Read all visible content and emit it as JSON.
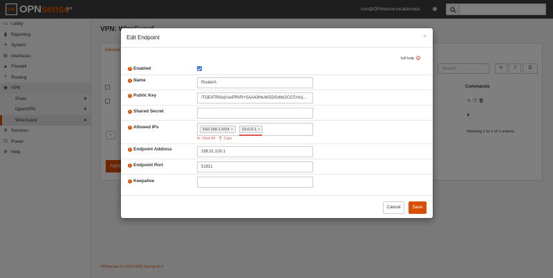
{
  "header": {
    "logo_text_opn": "OPN",
    "logo_text_sense": "sense",
    "logo_reg": "®",
    "collapse_icon": "chevron-left-icon",
    "user": "root@OPNsense.localdomain",
    "search_value": ""
  },
  "sidebar": {
    "items": [
      {
        "label": "Lobby",
        "icon": "laptop-icon"
      },
      {
        "label": "Reporting",
        "icon": "bar-chart-icon"
      },
      {
        "label": "System",
        "icon": "server-icon"
      },
      {
        "label": "Interfaces",
        "icon": "sitemap-icon"
      },
      {
        "label": "Firewall",
        "icon": "fire-icon"
      },
      {
        "label": "Routing",
        "icon": "signpost-icon"
      },
      {
        "label": "VPN",
        "icon": "globe-icon"
      },
      {
        "label": "Services",
        "icon": "cog-icon"
      },
      {
        "label": "Power",
        "icon": "power-icon"
      },
      {
        "label": "Help",
        "icon": "help-icon"
      }
    ],
    "vpn_sub": [
      {
        "label": "IPsec"
      },
      {
        "label": "OpenVPN"
      },
      {
        "label": "WireGuard"
      }
    ]
  },
  "background": {
    "page_title": "VPN: WireGuard",
    "tab_general": "General",
    "search_placeholder": "Search",
    "page_size": "7",
    "commands_header": "Commands",
    "showing": "Showing 1 to 1 of 1 entries",
    "apply_label": "Apply",
    "footer": "OPNsense (c) 2014-2022 Deciso B.V."
  },
  "modal": {
    "title": "Edit Endpoint",
    "close_symbol": "×",
    "full_help": "full help",
    "fields": {
      "enabled": {
        "label": "Enabled",
        "checked": true
      },
      "name": {
        "label": "Name",
        "value": "RouterA"
      },
      "public_key": {
        "label": "Public Key",
        "value": "/TOE4TRtAqVsePRVR+5AA43HkAK5DSnltkOCOTnVq..."
      },
      "shared_secret": {
        "label": "Shared Secret",
        "value": ""
      },
      "allowed_ips": {
        "label": "Allowed IPs",
        "tokens": [
          "192.168.1.0/24",
          "10.0.0.1"
        ],
        "clear_all": "Clear All",
        "copy": "Copy"
      },
      "endpoint_address": {
        "label": "Endpoint Address",
        "value": "198.51.100.1"
      },
      "endpoint_port": {
        "label": "Endpoint Port",
        "value": "51821"
      },
      "keepalive": {
        "label": "Keepalive",
        "value": ""
      }
    },
    "cancel_label": "Cancel",
    "save_label": "Save"
  },
  "colors": {
    "accent": "#d94f00",
    "topbar": "#3d3d3d",
    "checkbox": "#3b7dd8",
    "warning": "#d9534f"
  }
}
